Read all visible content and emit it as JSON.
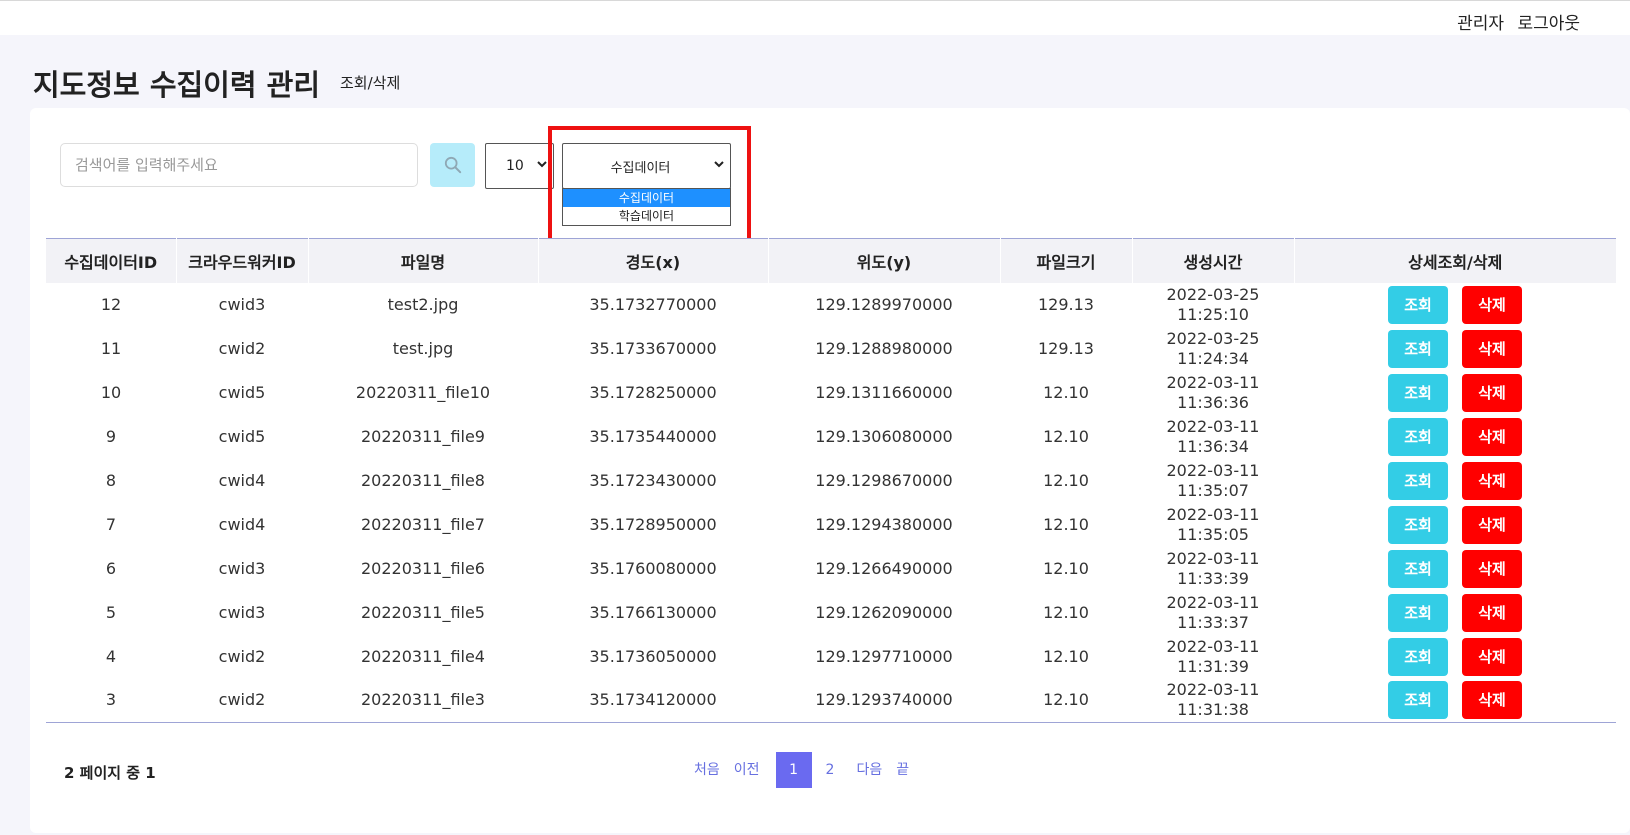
{
  "header": {
    "admin_label": "관리자",
    "logout_label": "로그아웃"
  },
  "page": {
    "title": "지도정보 수집이력 관리",
    "subtitle": "조회/삭제"
  },
  "search": {
    "placeholder": "검색어를 입력해주세요",
    "value": ""
  },
  "page_size": {
    "selected": "10"
  },
  "type_select": {
    "selected": "수집데이터",
    "options": [
      "수집데이터",
      "학습데이터"
    ],
    "highlighted_option": "수집데이터"
  },
  "table": {
    "columns": [
      "수집데이터ID",
      "크라우드워커ID",
      "파일명",
      "경도(x)",
      "위도(y)",
      "파일크기",
      "생성시간",
      "상세조회/삭제"
    ],
    "view_label": "조회",
    "delete_label": "삭제",
    "rows": [
      {
        "id": "12",
        "worker": "cwid3",
        "file": "test2.jpg",
        "lon": "35.1732770000",
        "lat": "129.1289970000",
        "size": "129.13",
        "date": "2022-03-25",
        "time": "11:25:10"
      },
      {
        "id": "11",
        "worker": "cwid2",
        "file": "test.jpg",
        "lon": "35.1733670000",
        "lat": "129.1288980000",
        "size": "129.13",
        "date": "2022-03-25",
        "time": "11:24:34"
      },
      {
        "id": "10",
        "worker": "cwid5",
        "file": "20220311_file10",
        "lon": "35.1728250000",
        "lat": "129.1311660000",
        "size": "12.10",
        "date": "2022-03-11",
        "time": "11:36:36"
      },
      {
        "id": "9",
        "worker": "cwid5",
        "file": "20220311_file9",
        "lon": "35.1735440000",
        "lat": "129.1306080000",
        "size": "12.10",
        "date": "2022-03-11",
        "time": "11:36:34"
      },
      {
        "id": "8",
        "worker": "cwid4",
        "file": "20220311_file8",
        "lon": "35.1723430000",
        "lat": "129.1298670000",
        "size": "12.10",
        "date": "2022-03-11",
        "time": "11:35:07"
      },
      {
        "id": "7",
        "worker": "cwid4",
        "file": "20220311_file7",
        "lon": "35.1728950000",
        "lat": "129.1294380000",
        "size": "12.10",
        "date": "2022-03-11",
        "time": "11:35:05"
      },
      {
        "id": "6",
        "worker": "cwid3",
        "file": "20220311_file6",
        "lon": "35.1760080000",
        "lat": "129.1266490000",
        "size": "12.10",
        "date": "2022-03-11",
        "time": "11:33:39"
      },
      {
        "id": "5",
        "worker": "cwid3",
        "file": "20220311_file5",
        "lon": "35.1766130000",
        "lat": "129.1262090000",
        "size": "12.10",
        "date": "2022-03-11",
        "time": "11:33:37"
      },
      {
        "id": "4",
        "worker": "cwid2",
        "file": "20220311_file4",
        "lon": "35.1736050000",
        "lat": "129.1297710000",
        "size": "12.10",
        "date": "2022-03-11",
        "time": "11:31:39"
      },
      {
        "id": "3",
        "worker": "cwid2",
        "file": "20220311_file3",
        "lon": "35.1734120000",
        "lat": "129.1293740000",
        "size": "12.10",
        "date": "2022-03-11",
        "time": "11:31:38"
      }
    ]
  },
  "pagination": {
    "info": "2 페이지 중 1",
    "first": "처음",
    "prev": "이전",
    "pages": [
      "1",
      "2"
    ],
    "current": "1",
    "next": "다음",
    "last": "끝"
  },
  "colors": {
    "view_button": "#33cde6",
    "delete_button": "#ff0000",
    "pager_active": "#6a6af0",
    "highlight_box": "#ee1111",
    "search_button": "#b6ecfa"
  }
}
